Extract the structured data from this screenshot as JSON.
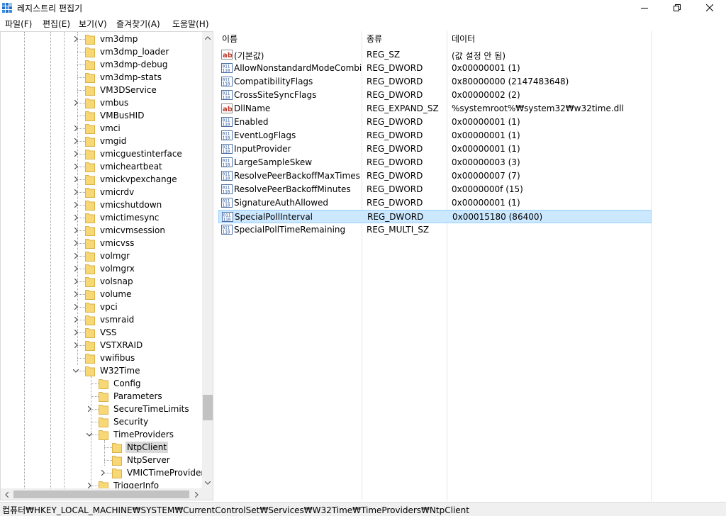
{
  "window": {
    "title": "레지스트리 편집기"
  },
  "menu": [
    "파일(F)",
    "편집(E)",
    "보기(V)",
    "즐겨찾기(A)",
    "도움말(H)"
  ],
  "tree": {
    "items": [
      {
        "label": "vm3dmp",
        "expandable": true
      },
      {
        "label": "vm3dmp_loader",
        "expandable": false
      },
      {
        "label": "vm3dmp-debug",
        "expandable": false
      },
      {
        "label": "vm3dmp-stats",
        "expandable": false
      },
      {
        "label": "VM3DService",
        "expandable": false
      },
      {
        "label": "vmbus",
        "expandable": true
      },
      {
        "label": "VMBusHID",
        "expandable": false
      },
      {
        "label": "vmci",
        "expandable": true
      },
      {
        "label": "vmgid",
        "expandable": true
      },
      {
        "label": "vmicguestinterface",
        "expandable": true
      },
      {
        "label": "vmicheartbeat",
        "expandable": true
      },
      {
        "label": "vmickvpexchange",
        "expandable": true
      },
      {
        "label": "vmicrdv",
        "expandable": true
      },
      {
        "label": "vmicshutdown",
        "expandable": true
      },
      {
        "label": "vmictimesync",
        "expandable": true
      },
      {
        "label": "vmicvmsession",
        "expandable": true
      },
      {
        "label": "vmicvss",
        "expandable": true
      },
      {
        "label": "volmgr",
        "expandable": true
      },
      {
        "label": "volmgrx",
        "expandable": true
      },
      {
        "label": "volsnap",
        "expandable": true
      },
      {
        "label": "volume",
        "expandable": true
      },
      {
        "label": "vpci",
        "expandable": true
      },
      {
        "label": "vsmraid",
        "expandable": true
      },
      {
        "label": "VSS",
        "expandable": true
      },
      {
        "label": "VSTXRAID",
        "expandable": true
      },
      {
        "label": "vwifibus",
        "expandable": false
      },
      {
        "label": "W32Time",
        "expandable": true,
        "expanded": true
      },
      {
        "label": "Config",
        "expandable": false
      },
      {
        "label": "Parameters",
        "expandable": false
      },
      {
        "label": "SecureTimeLimits",
        "expandable": true
      },
      {
        "label": "Security",
        "expandable": false
      },
      {
        "label": "TimeProviders",
        "expandable": true,
        "expanded": true
      },
      {
        "label": "NtpClient",
        "expandable": false,
        "selected": true
      },
      {
        "label": "NtpServer",
        "expandable": false
      },
      {
        "label": "VMICTimeProvider",
        "expandable": true
      },
      {
        "label": "TriggerInfo",
        "expandable": true
      }
    ]
  },
  "list": {
    "columns": [
      "이름",
      "종류",
      "데이터"
    ],
    "rows": [
      {
        "icon": "string-value-icon",
        "name": "(기본값)",
        "type": "REG_SZ",
        "data": "(값 설정 안 됨)"
      },
      {
        "icon": "binary-value-icon",
        "name": "AllowNonstandardModeCombi...",
        "type": "REG_DWORD",
        "data": "0x00000001 (1)"
      },
      {
        "icon": "binary-value-icon",
        "name": "CompatibilityFlags",
        "type": "REG_DWORD",
        "data": "0x80000000 (2147483648)"
      },
      {
        "icon": "binary-value-icon",
        "name": "CrossSiteSyncFlags",
        "type": "REG_DWORD",
        "data": "0x00000002 (2)"
      },
      {
        "icon": "string-value-icon",
        "name": "DllName",
        "type": "REG_EXPAND_SZ",
        "data": "%systemroot%₩system32₩w32time.dll"
      },
      {
        "icon": "binary-value-icon",
        "name": "Enabled",
        "type": "REG_DWORD",
        "data": "0x00000001 (1)"
      },
      {
        "icon": "binary-value-icon",
        "name": "EventLogFlags",
        "type": "REG_DWORD",
        "data": "0x00000001 (1)"
      },
      {
        "icon": "binary-value-icon",
        "name": "InputProvider",
        "type": "REG_DWORD",
        "data": "0x00000001 (1)"
      },
      {
        "icon": "binary-value-icon",
        "name": "LargeSampleSkew",
        "type": "REG_DWORD",
        "data": "0x00000003 (3)"
      },
      {
        "icon": "binary-value-icon",
        "name": "ResolvePeerBackoffMaxTimes",
        "type": "REG_DWORD",
        "data": "0x00000007 (7)"
      },
      {
        "icon": "binary-value-icon",
        "name": "ResolvePeerBackoffMinutes",
        "type": "REG_DWORD",
        "data": "0x0000000f (15)"
      },
      {
        "icon": "binary-value-icon",
        "name": "SignatureAuthAllowed",
        "type": "REG_DWORD",
        "data": "0x00000001 (1)"
      },
      {
        "icon": "binary-value-icon",
        "name": "SpecialPollInterval",
        "type": "REG_DWORD",
        "data": "0x00015180 (86400)",
        "selected": true
      },
      {
        "icon": "binary-value-icon",
        "name": "SpecialPollTimeRemaining",
        "type": "REG_MULTI_SZ",
        "data": ""
      }
    ]
  },
  "statusbar": {
    "path": "컴퓨터₩HKEY_LOCAL_MACHINE₩SYSTEM₩CurrentControlSet₩Services₩W32Time₩TimeProviders₩NtpClient"
  },
  "colors": {
    "folder": "#f8d775",
    "selection": "#cce8ff",
    "selection_border": "#99d1ff",
    "tree_selection": "#d9d9d9"
  }
}
